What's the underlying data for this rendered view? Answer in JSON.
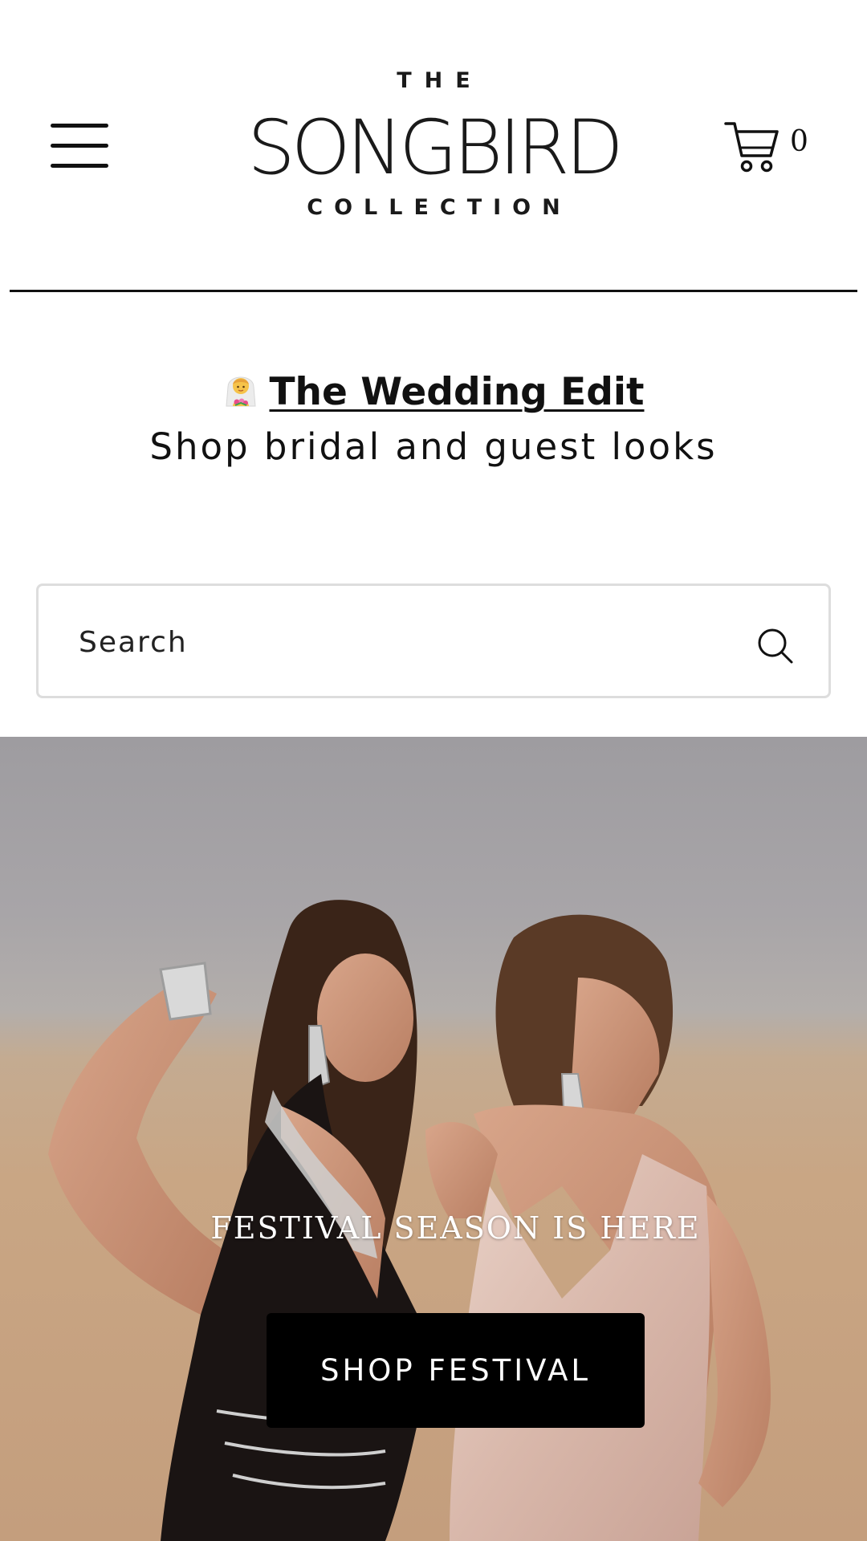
{
  "header": {
    "logo": {
      "the": "THE",
      "name": "SONGBIRD",
      "sub": "COLLECTION"
    },
    "menu_icon": "hamburger-menu-icon",
    "cart_icon": "shopping-cart-icon",
    "cart_count": "0"
  },
  "promo": {
    "icon": "bride-emoji-icon",
    "link_label": "The Wedding Edit",
    "subtitle": "Shop bridal and guest looks"
  },
  "search": {
    "placeholder": "Search",
    "icon": "search-icon"
  },
  "hero": {
    "heading": "FESTIVAL SEASON IS HERE",
    "button_label": "SHOP FESTIVAL"
  },
  "colors": {
    "text": "#111111",
    "button_bg": "#000000",
    "button_text": "#ffffff",
    "search_border": "#dddddd"
  }
}
